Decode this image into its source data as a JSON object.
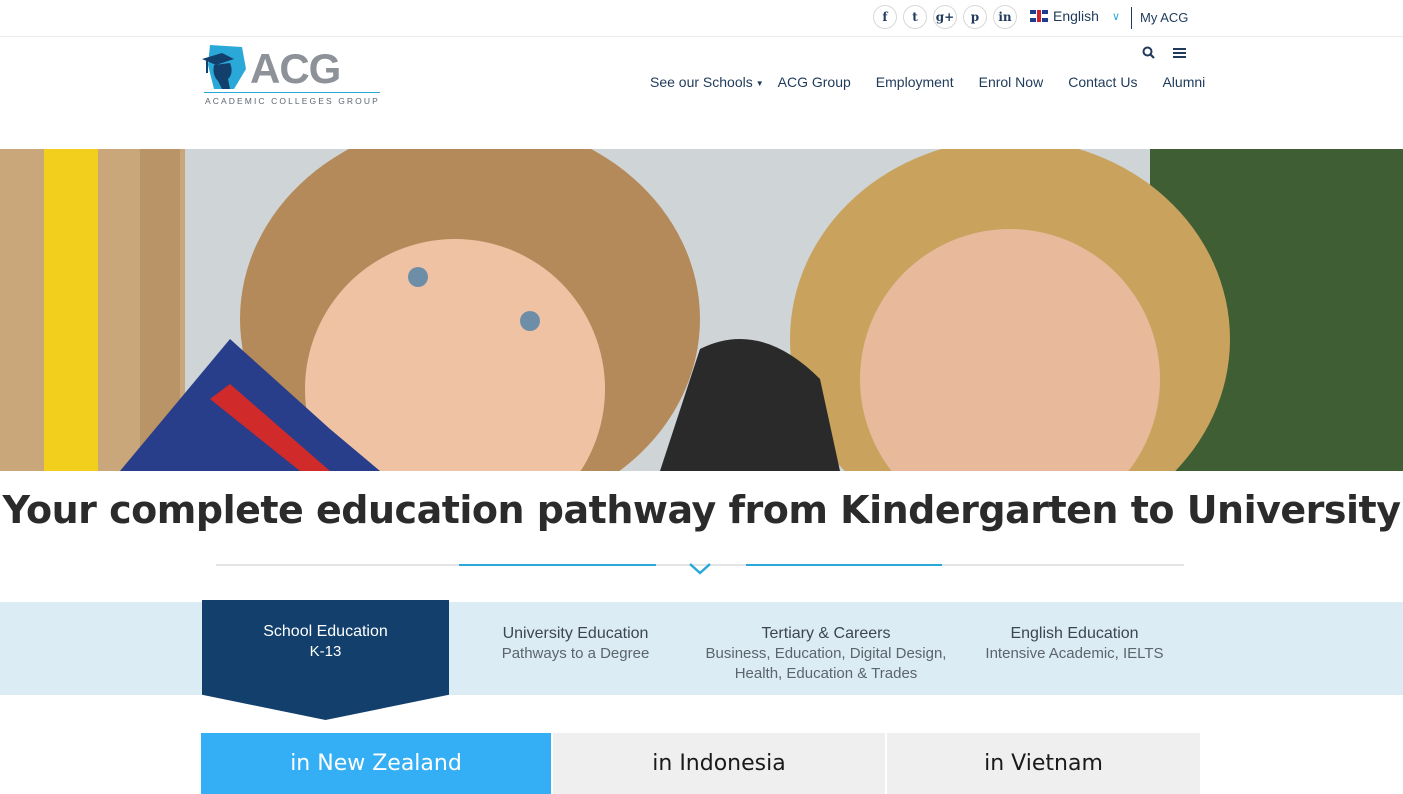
{
  "topbar": {
    "social": [
      {
        "icon": "facebook-icon",
        "glyph": "f"
      },
      {
        "icon": "twitter-icon",
        "glyph": "t"
      },
      {
        "icon": "googleplus-icon",
        "glyph": "g+"
      },
      {
        "icon": "pinterest-icon",
        "glyph": "p"
      },
      {
        "icon": "linkedin-icon",
        "glyph": "in"
      }
    ],
    "language": "English",
    "my_acg": "My ACG"
  },
  "logo": {
    "text": "ACG",
    "subtitle": "ACADEMIC COLLEGES GROUP"
  },
  "nav": {
    "items": [
      "See our Schools",
      "ACG Group",
      "Employment",
      "Enrol Now",
      "Contact Us",
      "Alumni"
    ]
  },
  "headline": "Your complete education pathway from Kindergarten to University",
  "tabs": [
    {
      "title": "School Education",
      "sub": "K-13"
    },
    {
      "title": "University Education",
      "sub": "Pathways to a Degree"
    },
    {
      "title": "Tertiary & Careers",
      "sub": "Business, Education, Digital Design,",
      "sub2": "Health, Education & Trades"
    },
    {
      "title": "English Education",
      "sub": "Intensive Academic, IELTS"
    }
  ],
  "locations": [
    "in New Zealand",
    "in Indonesia",
    "in Vietnam"
  ],
  "colors": {
    "navy": "#123f6b",
    "accent_blue": "#2aa8d8",
    "active_location": "#34aef4",
    "band": "#dcecf5"
  }
}
